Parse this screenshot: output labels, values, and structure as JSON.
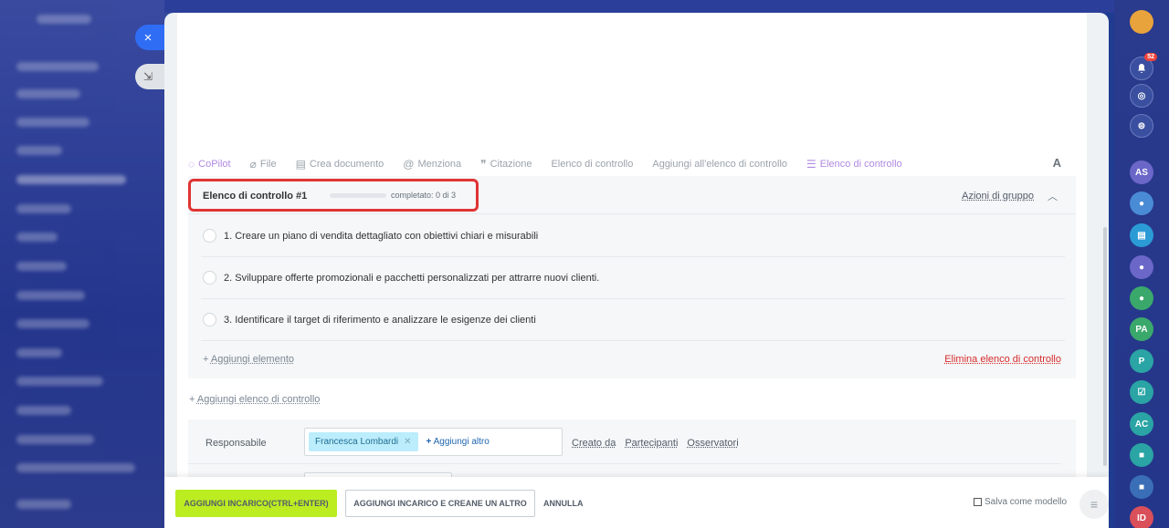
{
  "background": {
    "close_symbol": "×",
    "minimize_symbol": "⇲"
  },
  "rail": {
    "notification_count": "52",
    "avatars": [
      "AS",
      "PA",
      "P",
      "AC",
      "ID"
    ]
  },
  "toolbar": {
    "copilot": "CoPilot",
    "file": "File",
    "create_doc": "Crea documento",
    "mention": "Menziona",
    "quote": "Citazione",
    "checklist": "Elenco di controllo",
    "add_to_checklist": "Aggiungi all'elenco di controllo",
    "checklist_active": "Elenco di controllo",
    "font": "A"
  },
  "checklist": {
    "title": "Elenco di controllo #1",
    "progress": 0,
    "completed_text": "completato: 0 di 3",
    "group_actions": "Azioni di gruppo",
    "items": [
      {
        "text": "1. Creare un piano di vendita dettagliato con obiettivi chiari e misurabili"
      },
      {
        "text": "2. Sviluppare offerte promozionali e pacchetti personalizzati per attrarre nuovi clienti."
      },
      {
        "text": "3. Identificare il target di riferimento e analizzare le esigenze dei clienti"
      }
    ],
    "add_item": "Aggiungi elemento",
    "delete": "Elimina elenco di controllo"
  },
  "add_checklist": "Aggiungi elenco di controllo",
  "responsible": {
    "label": "Responsabile",
    "assignee": "Francesca Lombardi",
    "add_more": "Aggiungi altro",
    "links": [
      "Creato da",
      "Partecipanti",
      "Osservatori"
    ]
  },
  "footer": {
    "primary": "AGGIUNGI INCARICO(CTRL+ENTER)",
    "secondary": "AGGIUNGI INCARICO E CREANE UN ALTRO",
    "cancel": "ANNULLA",
    "save_template": "Salva come modello"
  }
}
